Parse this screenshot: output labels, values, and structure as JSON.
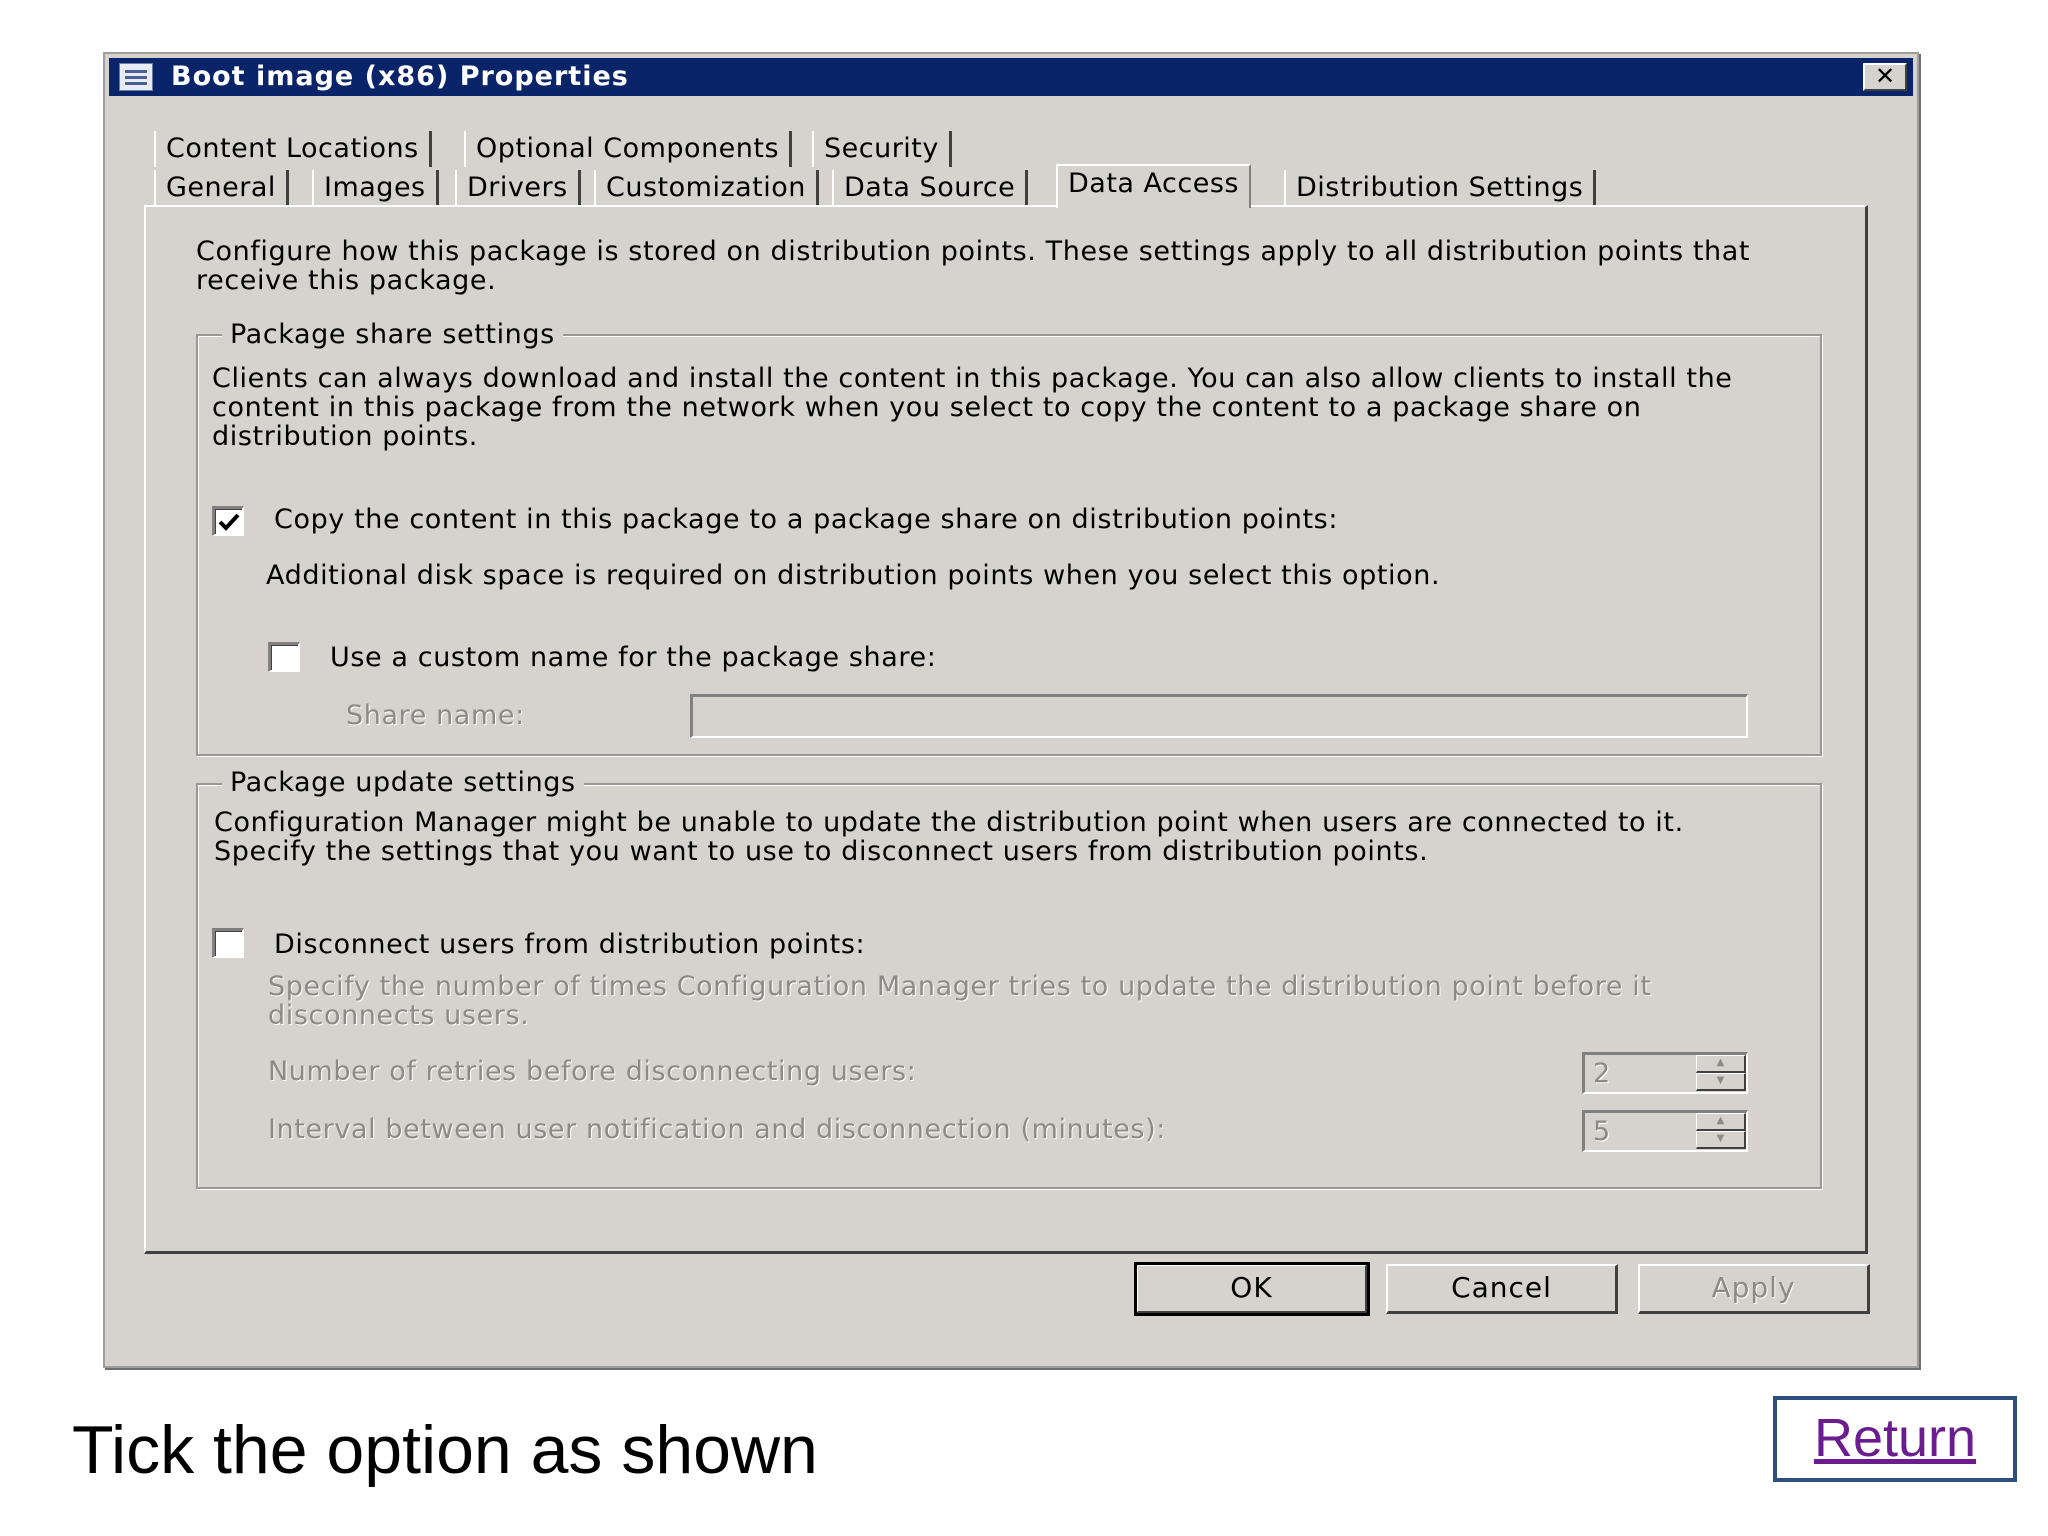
{
  "dialog": {
    "title": "Boot image (x86) Properties",
    "close_label": "✕"
  },
  "tabs": {
    "row1": [
      "Content Locations",
      "Optional Components",
      "Security"
    ],
    "row2": [
      "General",
      "Images",
      "Drivers",
      "Customization",
      "Data Source",
      "Data Access",
      "Distribution Settings"
    ],
    "active": "Data Access"
  },
  "panel": {
    "intro_line1": "Configure how this package is stored on distribution points. These settings apply to all distribution points that",
    "intro_line2": "receive this package.",
    "share_group": {
      "legend": "Package share settings",
      "desc_line1": "Clients can always download and install the content in this package. You can also allow clients to install the",
      "desc_line2": "content in this package from the network when you select to copy the content to a package share on",
      "desc_line3": "distribution points.",
      "copy_checkbox_label": "Copy the content in this package to a package share on distribution points:",
      "copy_checked": true,
      "disk_note": "Additional disk space is required on distribution points when you select this option.",
      "custom_name_label": "Use a custom name for the package share:",
      "custom_name_checked": false,
      "share_name_label": "Share name:",
      "share_name_value": ""
    },
    "update_group": {
      "legend": "Package update settings",
      "desc_line1": "Configuration Manager might be unable to update the distribution point when users are connected to it.",
      "desc_line2": "Specify the settings that you want to use to disconnect users from distribution points.",
      "disconnect_label": "Disconnect users from distribution points:",
      "disconnect_checked": false,
      "retries_desc_line1": "Specify the number of times Configuration Manager tries to update the distribution point before it",
      "retries_desc_line2": "disconnects users.",
      "retries_label": "Number of retries before disconnecting users:",
      "retries_value": "2",
      "interval_label": "Interval between user notification and disconnection (minutes):",
      "interval_value": "5"
    }
  },
  "buttons": {
    "ok": "OK",
    "cancel": "Cancel",
    "apply": "Apply"
  },
  "caption": "Tick the option as shown",
  "return_label": "Return"
}
